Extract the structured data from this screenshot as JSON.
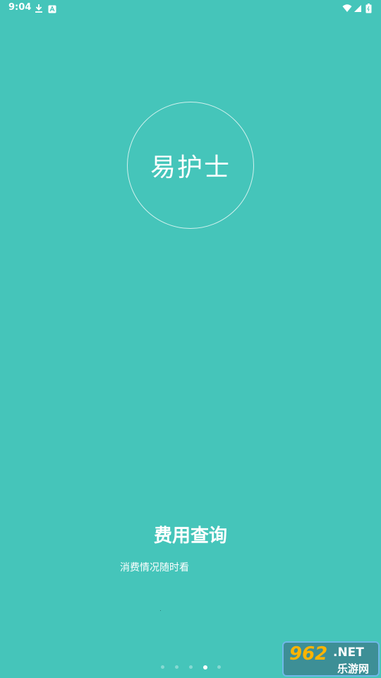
{
  "status_bar": {
    "time": "9:04",
    "icons": [
      "download-icon",
      "a-badge-icon",
      "wifi-icon",
      "signal-icon",
      "battery-icon"
    ]
  },
  "logo": {
    "text": "易护士"
  },
  "feature": {
    "title": "费用查询",
    "description": "消费情况随时看"
  },
  "pager": {
    "page_count": 5,
    "active_index": 3
  },
  "watermark": {
    "number": "962",
    "suffix": ".NET",
    "sub": "乐游网"
  },
  "colors": {
    "background": "#45c5ba",
    "text": "#ffffff",
    "watermark_orange": "#ffb400"
  }
}
